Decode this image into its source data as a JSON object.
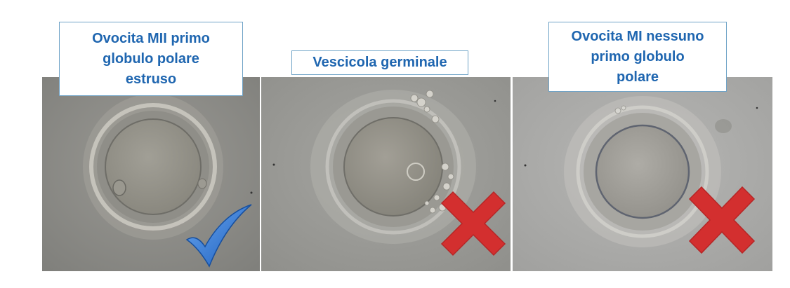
{
  "panels": [
    {
      "caption": "Ovocita MII primo\nglobulo polare\nestruso",
      "verdict": "accepted",
      "icon": "check-mark-icon"
    },
    {
      "caption": "Vescicola germinale",
      "verdict": "rejected",
      "icon": "cross-mark-icon"
    },
    {
      "caption": "Ovocita MI nessuno\nprimo globulo\npolare",
      "verdict": "rejected",
      "icon": "cross-mark-icon"
    }
  ],
  "colors": {
    "caption_text": "#1f66b0",
    "caption_border": "#6fa3c7",
    "check": "#2a72d4",
    "cross": "#d32f2f",
    "micrograph_bg": "#8c8c88"
  }
}
